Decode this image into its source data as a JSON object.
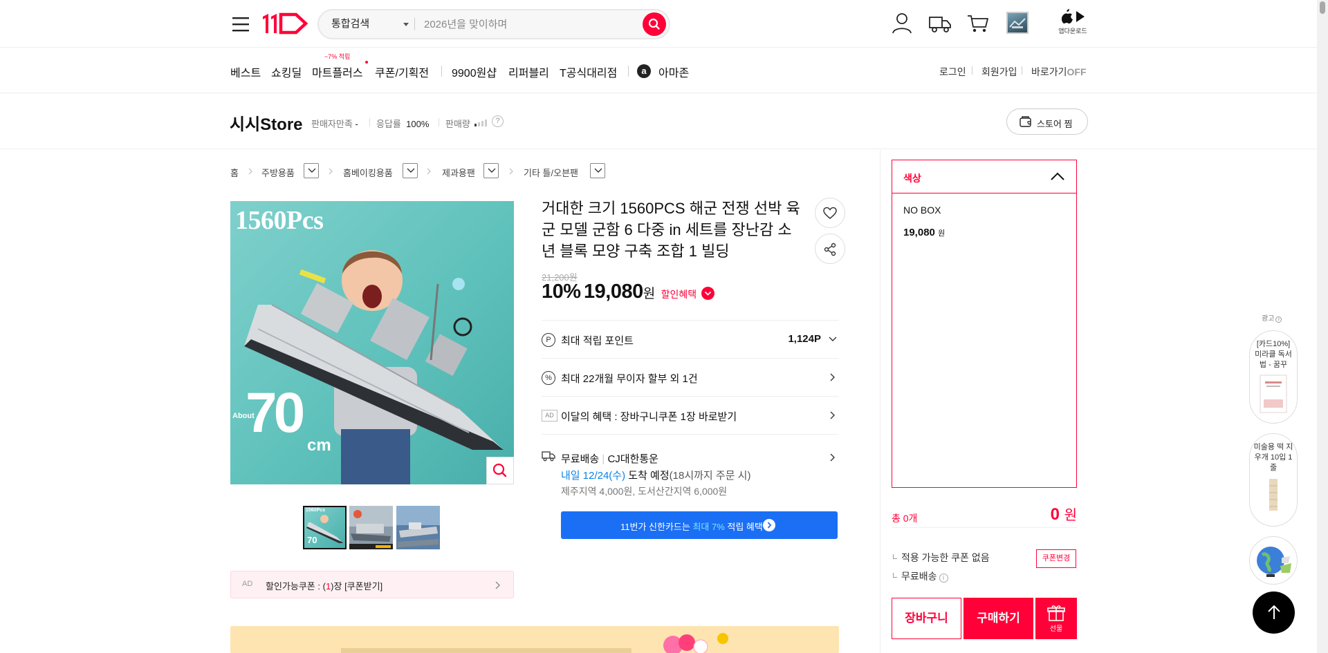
{
  "header": {
    "search_category": "통합검색",
    "search_placeholder": "2026년을 맞이하며",
    "app_download": "앱다운로드"
  },
  "nav": {
    "items": [
      "베스트",
      "쇼킹딜",
      "마트플러스",
      "쿠폰/기획전",
      "9900원샵",
      "리퍼블리",
      "T공식대리점",
      "아마존"
    ],
    "mart_badge": "~7% 적립",
    "amazon_icon": "a",
    "util": [
      "로그인",
      "회원가입"
    ],
    "shortcut_label": "바로가기",
    "shortcut_state": "OFF"
  },
  "store": {
    "name": "시시Store",
    "satisfaction_label": "판매자만족",
    "satisfaction_value": "-",
    "response_label": "응답률",
    "response_value": "100%",
    "sales_label": "판매량",
    "help": "?",
    "fav_button": "스토어 찜"
  },
  "breadcrumb": [
    "홈",
    "주방용품",
    "홈베이킹용품",
    "제과용팬",
    "기타 틀/오븐팬"
  ],
  "image": {
    "pcs_text": "1560Pcs",
    "about_text": "About",
    "size_number": "70",
    "size_unit": "cm",
    "thumb1_text": "1560Pcs",
    "thumb1_size": "70"
  },
  "coupon_bar": {
    "ad": "AD",
    "text_before": "할인가능쿠폰 : (",
    "count": "1",
    "text_after": ")장 [쿠폰받기]"
  },
  "product": {
    "title": "거대한 크기 1560PCS 해군 전쟁 선박 육군 모델 군함 6 다중 in 세트를 장난감 소년 블록 모양 구축 조합 1 빌딩",
    "original_price": "21,200원",
    "discount": "10%",
    "price": "19,080",
    "won": "원",
    "benefit": "할인혜택"
  },
  "info_rows": {
    "points_icon": "P",
    "points_label": "최대 적립 포인트",
    "points_value": "1,124P",
    "installment_icon": "%",
    "installment_label": "최대 22개월 무이자 할부 외 1건",
    "ad": "AD",
    "monthly_label": "이달의 혜택 : 장바구니쿠폰 1장 바로받기",
    "shipping_label": "무료배송",
    "shipping_courier": "CJ대한통운",
    "arrival_date": "내일 12/24(수)",
    "arrival_text": "도착 예정",
    "arrival_note": "(18시까지 주문 시)",
    "extra_fee": "제주지역 4,000원, 도서산간지역 6,000원"
  },
  "card_banner": {
    "text_before": "11번가 신한카드는 ",
    "highlight": "최대 7%",
    "text_after": " 적립 혜택"
  },
  "option_panel": {
    "header": "색상",
    "item_name": "NO BOX",
    "item_price": "19,080",
    "item_won": "원",
    "total_count": "총 0개",
    "total_amount": "0",
    "total_won": "원",
    "coupon_info": "적용 가능한 쿠폰 없음",
    "coupon_change": "쿠폰변경",
    "free_shipping": "무료배송",
    "info_i": "i",
    "cart_button": "장바구니",
    "buy_button": "구매하기",
    "gift_button": "선물"
  },
  "side_ads": {
    "label": "광고",
    "label_icon": "i",
    "ad1": "[카드10%] 미라클 독서법 - 꿈꾸",
    "ad2": "미술용 떡 지우개 10입 1줄"
  },
  "colors": {
    "brand_red": "#ff0038",
    "card_blue": "#1a6ff5",
    "delivery_blue": "#0b83e6",
    "image_teal": "#5fc1bb"
  }
}
